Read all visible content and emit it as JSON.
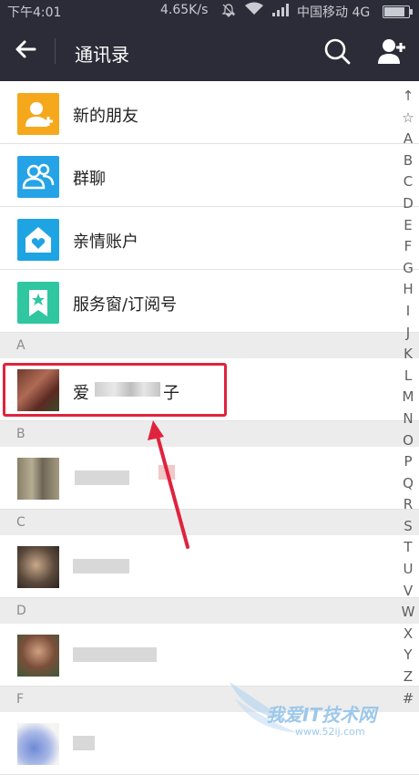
{
  "status_bar": {
    "time": "下午4:01",
    "speed": "4.65K/s",
    "carrier": "中国移动 4G",
    "battery_level": 0.85
  },
  "header": {
    "title": "通讯录"
  },
  "menu": [
    {
      "label": "新的朋友",
      "color": "#f6a81d",
      "icon": "new-friend-icon"
    },
    {
      "label": "群聊",
      "color": "#25a3e6",
      "icon": "group-chat-icon"
    },
    {
      "label": "亲情账户",
      "color": "#1fa4e3",
      "icon": "family-account-icon"
    },
    {
      "label": "服务窗/订阅号",
      "color": "#2fc6a0",
      "icon": "service-window-icon"
    }
  ],
  "sections": [
    {
      "letter": "A",
      "contacts": [
        {
          "name_start": "爱",
          "name_end": "子"
        }
      ]
    },
    {
      "letter": "B",
      "contacts": [
        {}
      ]
    },
    {
      "letter": "C",
      "contacts": [
        {}
      ]
    },
    {
      "letter": "D",
      "contacts": [
        {}
      ]
    },
    {
      "letter": "F",
      "contacts": [
        {}
      ]
    }
  ],
  "index": [
    "↑",
    "☆",
    "A",
    "B",
    "C",
    "D",
    "E",
    "F",
    "G",
    "H",
    "I",
    "J",
    "K",
    "L",
    "M",
    "N",
    "O",
    "P",
    "Q",
    "R",
    "S",
    "T",
    "U",
    "V",
    "W",
    "X",
    "Y",
    "Z",
    "#"
  ],
  "watermark": {
    "text": "我爱IT技术网",
    "url": "www.52ij.com"
  },
  "annotation_color": "#e0233d"
}
